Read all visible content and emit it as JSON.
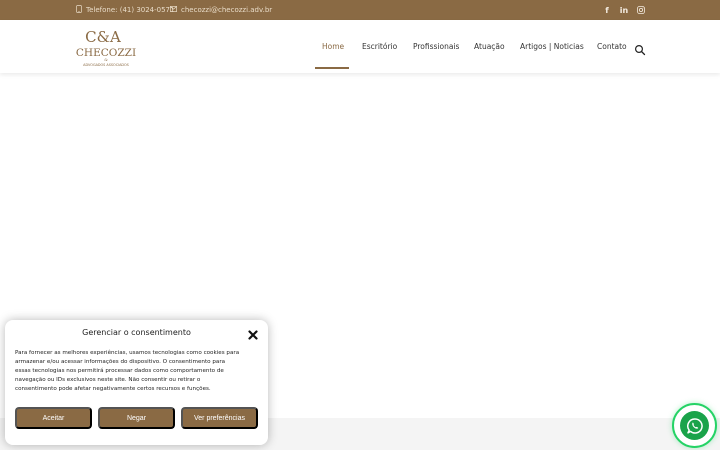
{
  "topbar": {
    "phone": "Telefone: (41) 3024-0571",
    "email": "checozzi@checozzi.adv.br",
    "social": [
      "f",
      "in",
      "ig"
    ]
  },
  "logo": {
    "monogram": "C&A",
    "name": "CHECOZZI",
    "amp": "&",
    "tagline": "ADVOGADOS ASSOCIADOS"
  },
  "nav": {
    "items": [
      "Home",
      "Escritório",
      "Profissionais",
      "Atuação",
      "Artigos | Noticias",
      "Contato"
    ],
    "active": "Home"
  },
  "consent": {
    "title": "Gerenciar o consentimento",
    "lines": [
      "Para fornecer as melhores experiências, usamos tecnologias como cookies para",
      "armazenar e/ou acessar informações do dispositivo. O consentimento para",
      "essas tecnologias nos permitirá processar dados como comportamento de",
      "navegação ou IDs exclusivos neste site. Não consentir ou retirar o",
      "consentimento pode afetar negativamente certos recursos e funções."
    ],
    "accept_label": "Aceitar",
    "deny_label": "Negar",
    "preferences_label": "Ver preferências"
  },
  "colors": {
    "brand": "#8a6a44",
    "whatsapp": "#25d366"
  },
  "icons": [
    "phone-icon",
    "mail-icon",
    "facebook-icon",
    "linkedin-icon",
    "instagram-icon",
    "search-icon",
    "close-icon",
    "whatsapp-icon"
  ]
}
